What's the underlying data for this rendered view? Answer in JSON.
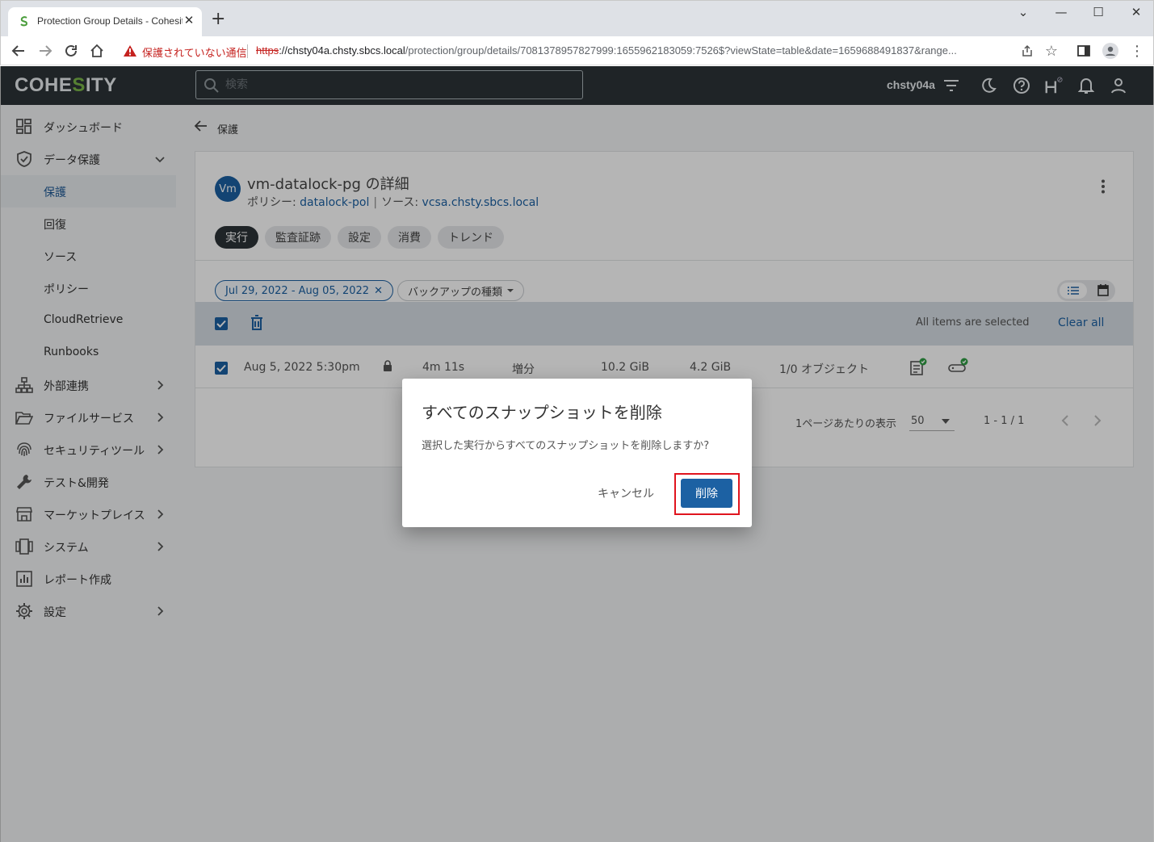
{
  "browser": {
    "tab_title": "Protection Group Details - Cohesity",
    "insecure_label": "保護されていない通信",
    "url_scheme": "https",
    "url_host": "://chsty04a.chsty.sbcs.local",
    "url_path": "/protection/group/details/7081378957827999:1655962183059:7526$?viewState=table&date=1659688491837&range..."
  },
  "app": {
    "logo_pre": "COHE",
    "logo_mid": "S",
    "logo_post": "ITY",
    "search_placeholder": "検索",
    "cluster": "chsty04a"
  },
  "sidebar": {
    "items": [
      {
        "label": "ダッシュボード"
      },
      {
        "label": "データ保護"
      },
      {
        "label": "保護"
      },
      {
        "label": "回復"
      },
      {
        "label": "ソース"
      },
      {
        "label": "ポリシー"
      },
      {
        "label": "CloudRetrieve"
      },
      {
        "label": "Runbooks"
      },
      {
        "label": "外部連携"
      },
      {
        "label": "ファイルサービス"
      },
      {
        "label": "セキュリティツール"
      },
      {
        "label": "テスト&開発"
      },
      {
        "label": "マーケットプレイス"
      },
      {
        "label": "システム"
      },
      {
        "label": "レポート作成"
      },
      {
        "label": "設定"
      }
    ]
  },
  "page": {
    "back_label": "保護",
    "avatar": "Vm",
    "title": "vm-datalock-pg の詳細",
    "policy_label": "ポリシー: ",
    "policy_value": "datalock-pol",
    "source_label": "ソース: ",
    "source_value": "vcsa.chsty.sbcs.local",
    "tabs": [
      {
        "label": "実行"
      },
      {
        "label": "監査証跡"
      },
      {
        "label": "設定"
      },
      {
        "label": "消費"
      },
      {
        "label": "トレンド"
      }
    ],
    "date_filter": "Jul 29, 2022 - Aug 05, 2022",
    "type_filter": "バックアップの種類",
    "selection_text": "All items are selected",
    "clear_all": "Clear all",
    "row": {
      "start": "Aug 5, 2022 5:30pm",
      "duration": "4m 11s",
      "type": "増分",
      "size1": "10.2 GiB",
      "size2": "4.2 GiB",
      "objects": "1/0 オブジェクト"
    },
    "pager": {
      "per_page_label": "1ページあたりの表示",
      "per_page_value": "50",
      "range": "1 - 1 / 1"
    }
  },
  "dialog": {
    "title": "すべてのスナップショットを削除",
    "message": "選択した実行からすべてのスナップショットを削除しますか?",
    "cancel": "キャンセル",
    "delete": "削除"
  },
  "colors": {
    "primary": "#1c61a3",
    "header_bg": "#2d3438",
    "highlight": "#e0141e",
    "brand_green": "#7ab648"
  }
}
